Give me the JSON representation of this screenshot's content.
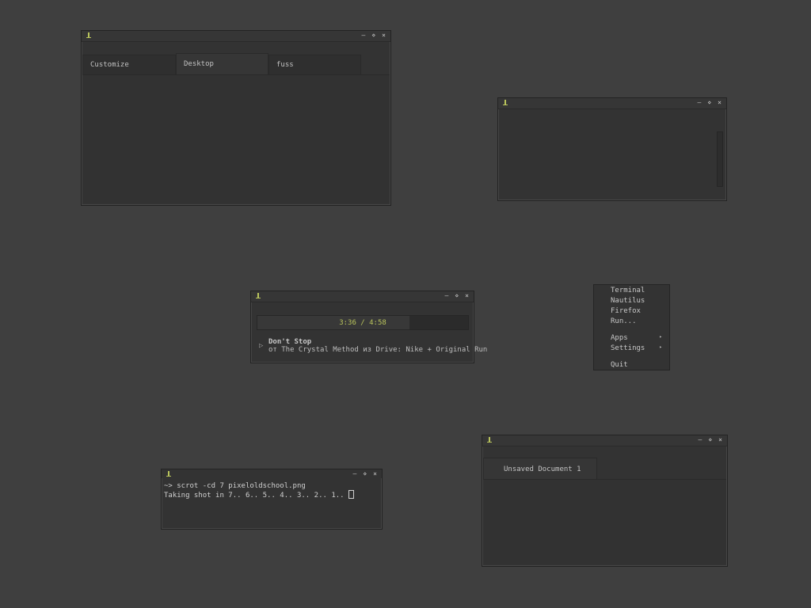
{
  "window_controls": {
    "minimize": "–",
    "maximize": "⋄",
    "close": "×"
  },
  "preferences_window": {
    "tabs": [
      {
        "label": "Customize",
        "active": false
      },
      {
        "label": "Desktop",
        "active": true
      },
      {
        "label": "fuss",
        "active": false
      }
    ]
  },
  "music_player": {
    "progress": "3:36 / 4:58",
    "progress_fraction": 0.72,
    "track_title": "Don't Stop",
    "track_subtitle": "от The Crystal Method из Drive: Nike + Original Run"
  },
  "desktop_menu": {
    "items": [
      {
        "label": "Terminal",
        "submenu": false
      },
      {
        "label": "Nautilus",
        "submenu": false
      },
      {
        "label": "Firefox",
        "submenu": false
      },
      {
        "label": "Run...",
        "submenu": false
      },
      {
        "label": "Apps",
        "submenu": true
      },
      {
        "label": "Settings",
        "submenu": true
      },
      {
        "label": "Quit",
        "submenu": false
      }
    ],
    "submenu_arrow": "▸"
  },
  "terminal": {
    "line1": "~> scrot -cd 7 pixeloldschool.png",
    "line2": "Taking shot in 7.. 6.. 5.. 4.. 3.. 2.. 1.. "
  },
  "editor": {
    "tab": "Unsaved Document 1"
  },
  "colors": {
    "desktop": "#3f3f3f",
    "window": "#333333",
    "accent": "#b9c45c"
  }
}
